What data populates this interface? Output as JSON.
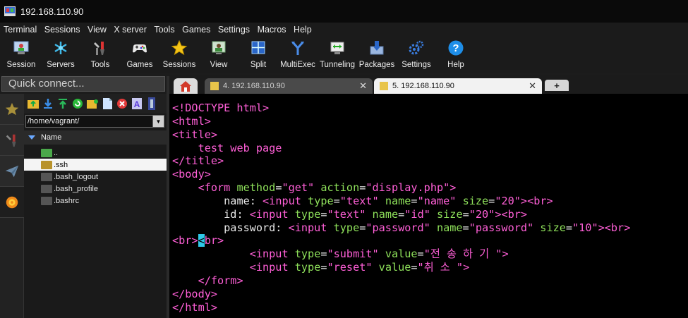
{
  "window": {
    "title": "192.168.110.90"
  },
  "menu": [
    "Terminal",
    "Sessions",
    "View",
    "X server",
    "Tools",
    "Games",
    "Settings",
    "Macros",
    "Help"
  ],
  "toolbar": [
    {
      "label": "Session",
      "icon": "session-icon"
    },
    {
      "label": "Servers",
      "icon": "servers-icon"
    },
    {
      "label": "Tools",
      "icon": "tools-icon"
    },
    {
      "label": "Games",
      "icon": "games-icon"
    },
    {
      "label": "Sessions",
      "icon": "sessions-star-icon"
    },
    {
      "label": "View",
      "icon": "view-icon"
    },
    {
      "label": "Split",
      "icon": "split-icon"
    },
    {
      "label": "MultiExec",
      "icon": "multiexec-icon"
    },
    {
      "label": "Tunneling",
      "icon": "tunneling-icon"
    },
    {
      "label": "Packages",
      "icon": "packages-icon"
    },
    {
      "label": "Settings",
      "icon": "settings-icon"
    },
    {
      "label": "Help",
      "icon": "help-icon"
    }
  ],
  "quick_connect": {
    "placeholder": "Quick connect..."
  },
  "sftp": {
    "path": "/home/vagrant/",
    "column": "Name",
    "files": [
      {
        "name": "..",
        "type": "parent"
      },
      {
        "name": ".ssh",
        "type": "folder",
        "selected": true
      },
      {
        "name": ".bash_logout",
        "type": "file"
      },
      {
        "name": ".bash_profile",
        "type": "file"
      },
      {
        "name": ".bashrc",
        "type": "file"
      }
    ]
  },
  "tabs": {
    "tab4": "4. 192.168.110.90",
    "tab5": "5. 192.168.110.90",
    "close": "✕",
    "add": "+"
  },
  "terminal": {
    "l1": "<!DOCTYPE html>",
    "l2": "<html>",
    "l3": "<title>",
    "l4": "test web page",
    "l5": "</title>",
    "l6": "<body>",
    "l7_tag_open": "<form",
    "l7_attr1": "method",
    "l7_val1": "\"get\"",
    "l7_attr2": "action",
    "l7_val2": "\"display.php\"",
    "l7_close": ">",
    "label_name": "name:",
    "label_id": "id:",
    "label_password": "password:",
    "input_tag": "<input",
    "type_attr": "type",
    "name_attr": "name",
    "size_attr": "size",
    "value_attr": "value",
    "v_text": "\"text\"",
    "v_name": "\"name\"",
    "v_id": "\"id\"",
    "v_20": "\"20\"",
    "v_password": "\"password\"",
    "v_10": "\"10\"",
    "br": "<br>",
    "v_submit": "\"submit\"",
    "v_submit_val": "\"전 송 하 기 \"",
    "v_reset": "\"reset\"",
    "v_reset_val": "\"취 소 \"",
    "form_close": "</form>",
    "body_close": "</body>",
    "html_close": "</html>"
  }
}
